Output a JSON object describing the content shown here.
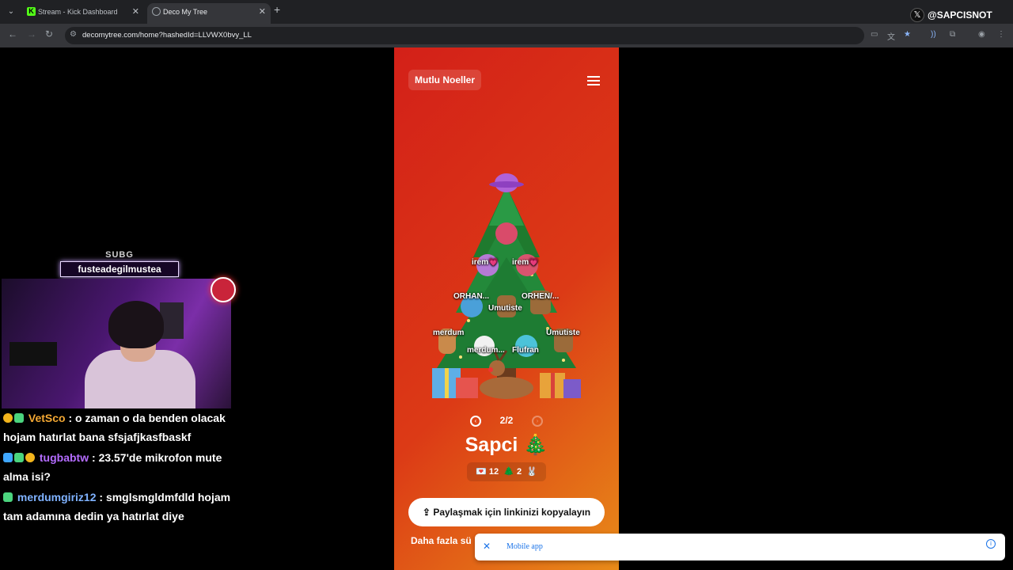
{
  "browser": {
    "tabs": [
      {
        "title": "Stream - Kick Dashboard",
        "active": false,
        "favicon": "kick-icon"
      },
      {
        "title": "Deco My Tree",
        "active": true,
        "favicon": "globe-icon"
      }
    ],
    "url": "decomytree.com/home?hashedId=LLVWX0bvy_LL",
    "watermark": "@SAPCISNOT"
  },
  "stream": {
    "sub_alert": {
      "tag": "SUBG",
      "username": "fusteadegilmustea"
    },
    "chat": [
      {
        "user": "VetSco",
        "color": "#f3a833",
        "badges": [
          "gold",
          "green"
        ],
        "text": "o zaman o da benden olacak hojam hatırlat bana sfsjafjkasfbaskf"
      },
      {
        "user": "tugbabtw",
        "color": "#b46cff",
        "badges": [
          "blue",
          "green",
          "gold"
        ],
        "text": "23.57'de mikrofon mute alma isi?"
      },
      {
        "user": "merdumgiriz12",
        "color": "#7fb2ff",
        "badges": [
          "green"
        ],
        "text": "smglsmgldmfdld hojam tam adamına dedin ya hatırlat diye"
      }
    ]
  },
  "app": {
    "brand": "Mutlu Noeller",
    "ornaments": [
      {
        "label": "irem💗"
      },
      {
        "label": "irem💗"
      },
      {
        "label": "ORHAN..."
      },
      {
        "label": "Umutiste"
      },
      {
        "label": "ORHEN/..."
      },
      {
        "label": "merdum"
      },
      {
        "label": "Umutiste"
      },
      {
        "label": "merdum..."
      },
      {
        "label": "Flufran"
      }
    ],
    "pager": "2/2",
    "owner": "Sapci 🎄",
    "stats": {
      "messages": "12",
      "trees": "2"
    },
    "share_label": "Paylaşmak için linkinizi kopyalayın",
    "more_label": "Daha fazla sü"
  },
  "banner": {
    "label": "Mobile app"
  }
}
